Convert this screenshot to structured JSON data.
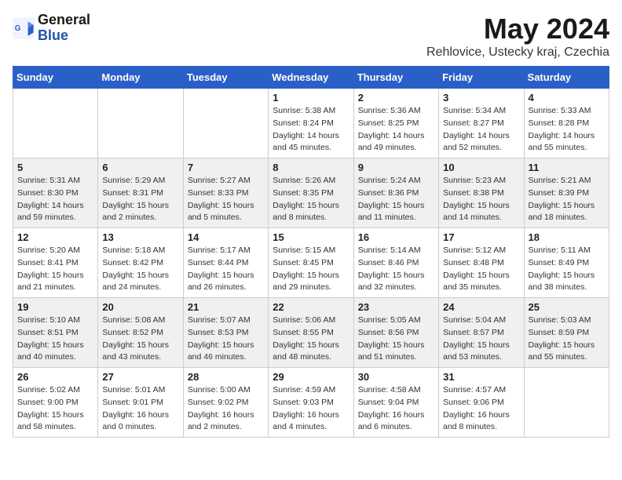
{
  "header": {
    "logo_line1": "General",
    "logo_line2": "Blue",
    "month": "May 2024",
    "location": "Rehlovice, Ustecky kraj, Czechia"
  },
  "days_of_week": [
    "Sunday",
    "Monday",
    "Tuesday",
    "Wednesday",
    "Thursday",
    "Friday",
    "Saturday"
  ],
  "weeks": [
    [
      {
        "day": "",
        "detail": ""
      },
      {
        "day": "",
        "detail": ""
      },
      {
        "day": "",
        "detail": ""
      },
      {
        "day": "1",
        "detail": "Sunrise: 5:38 AM\nSunset: 8:24 PM\nDaylight: 14 hours\nand 45 minutes."
      },
      {
        "day": "2",
        "detail": "Sunrise: 5:36 AM\nSunset: 8:25 PM\nDaylight: 14 hours\nand 49 minutes."
      },
      {
        "day": "3",
        "detail": "Sunrise: 5:34 AM\nSunset: 8:27 PM\nDaylight: 14 hours\nand 52 minutes."
      },
      {
        "day": "4",
        "detail": "Sunrise: 5:33 AM\nSunset: 8:28 PM\nDaylight: 14 hours\nand 55 minutes."
      }
    ],
    [
      {
        "day": "5",
        "detail": "Sunrise: 5:31 AM\nSunset: 8:30 PM\nDaylight: 14 hours\nand 59 minutes."
      },
      {
        "day": "6",
        "detail": "Sunrise: 5:29 AM\nSunset: 8:31 PM\nDaylight: 15 hours\nand 2 minutes."
      },
      {
        "day": "7",
        "detail": "Sunrise: 5:27 AM\nSunset: 8:33 PM\nDaylight: 15 hours\nand 5 minutes."
      },
      {
        "day": "8",
        "detail": "Sunrise: 5:26 AM\nSunset: 8:35 PM\nDaylight: 15 hours\nand 8 minutes."
      },
      {
        "day": "9",
        "detail": "Sunrise: 5:24 AM\nSunset: 8:36 PM\nDaylight: 15 hours\nand 11 minutes."
      },
      {
        "day": "10",
        "detail": "Sunrise: 5:23 AM\nSunset: 8:38 PM\nDaylight: 15 hours\nand 14 minutes."
      },
      {
        "day": "11",
        "detail": "Sunrise: 5:21 AM\nSunset: 8:39 PM\nDaylight: 15 hours\nand 18 minutes."
      }
    ],
    [
      {
        "day": "12",
        "detail": "Sunrise: 5:20 AM\nSunset: 8:41 PM\nDaylight: 15 hours\nand 21 minutes."
      },
      {
        "day": "13",
        "detail": "Sunrise: 5:18 AM\nSunset: 8:42 PM\nDaylight: 15 hours\nand 24 minutes."
      },
      {
        "day": "14",
        "detail": "Sunrise: 5:17 AM\nSunset: 8:44 PM\nDaylight: 15 hours\nand 26 minutes."
      },
      {
        "day": "15",
        "detail": "Sunrise: 5:15 AM\nSunset: 8:45 PM\nDaylight: 15 hours\nand 29 minutes."
      },
      {
        "day": "16",
        "detail": "Sunrise: 5:14 AM\nSunset: 8:46 PM\nDaylight: 15 hours\nand 32 minutes."
      },
      {
        "day": "17",
        "detail": "Sunrise: 5:12 AM\nSunset: 8:48 PM\nDaylight: 15 hours\nand 35 minutes."
      },
      {
        "day": "18",
        "detail": "Sunrise: 5:11 AM\nSunset: 8:49 PM\nDaylight: 15 hours\nand 38 minutes."
      }
    ],
    [
      {
        "day": "19",
        "detail": "Sunrise: 5:10 AM\nSunset: 8:51 PM\nDaylight: 15 hours\nand 40 minutes."
      },
      {
        "day": "20",
        "detail": "Sunrise: 5:08 AM\nSunset: 8:52 PM\nDaylight: 15 hours\nand 43 minutes."
      },
      {
        "day": "21",
        "detail": "Sunrise: 5:07 AM\nSunset: 8:53 PM\nDaylight: 15 hours\nand 46 minutes."
      },
      {
        "day": "22",
        "detail": "Sunrise: 5:06 AM\nSunset: 8:55 PM\nDaylight: 15 hours\nand 48 minutes."
      },
      {
        "day": "23",
        "detail": "Sunrise: 5:05 AM\nSunset: 8:56 PM\nDaylight: 15 hours\nand 51 minutes."
      },
      {
        "day": "24",
        "detail": "Sunrise: 5:04 AM\nSunset: 8:57 PM\nDaylight: 15 hours\nand 53 minutes."
      },
      {
        "day": "25",
        "detail": "Sunrise: 5:03 AM\nSunset: 8:59 PM\nDaylight: 15 hours\nand 55 minutes."
      }
    ],
    [
      {
        "day": "26",
        "detail": "Sunrise: 5:02 AM\nSunset: 9:00 PM\nDaylight: 15 hours\nand 58 minutes."
      },
      {
        "day": "27",
        "detail": "Sunrise: 5:01 AM\nSunset: 9:01 PM\nDaylight: 16 hours\nand 0 minutes."
      },
      {
        "day": "28",
        "detail": "Sunrise: 5:00 AM\nSunset: 9:02 PM\nDaylight: 16 hours\nand 2 minutes."
      },
      {
        "day": "29",
        "detail": "Sunrise: 4:59 AM\nSunset: 9:03 PM\nDaylight: 16 hours\nand 4 minutes."
      },
      {
        "day": "30",
        "detail": "Sunrise: 4:58 AM\nSunset: 9:04 PM\nDaylight: 16 hours\nand 6 minutes."
      },
      {
        "day": "31",
        "detail": "Sunrise: 4:57 AM\nSunset: 9:06 PM\nDaylight: 16 hours\nand 8 minutes."
      },
      {
        "day": "",
        "detail": ""
      }
    ]
  ]
}
